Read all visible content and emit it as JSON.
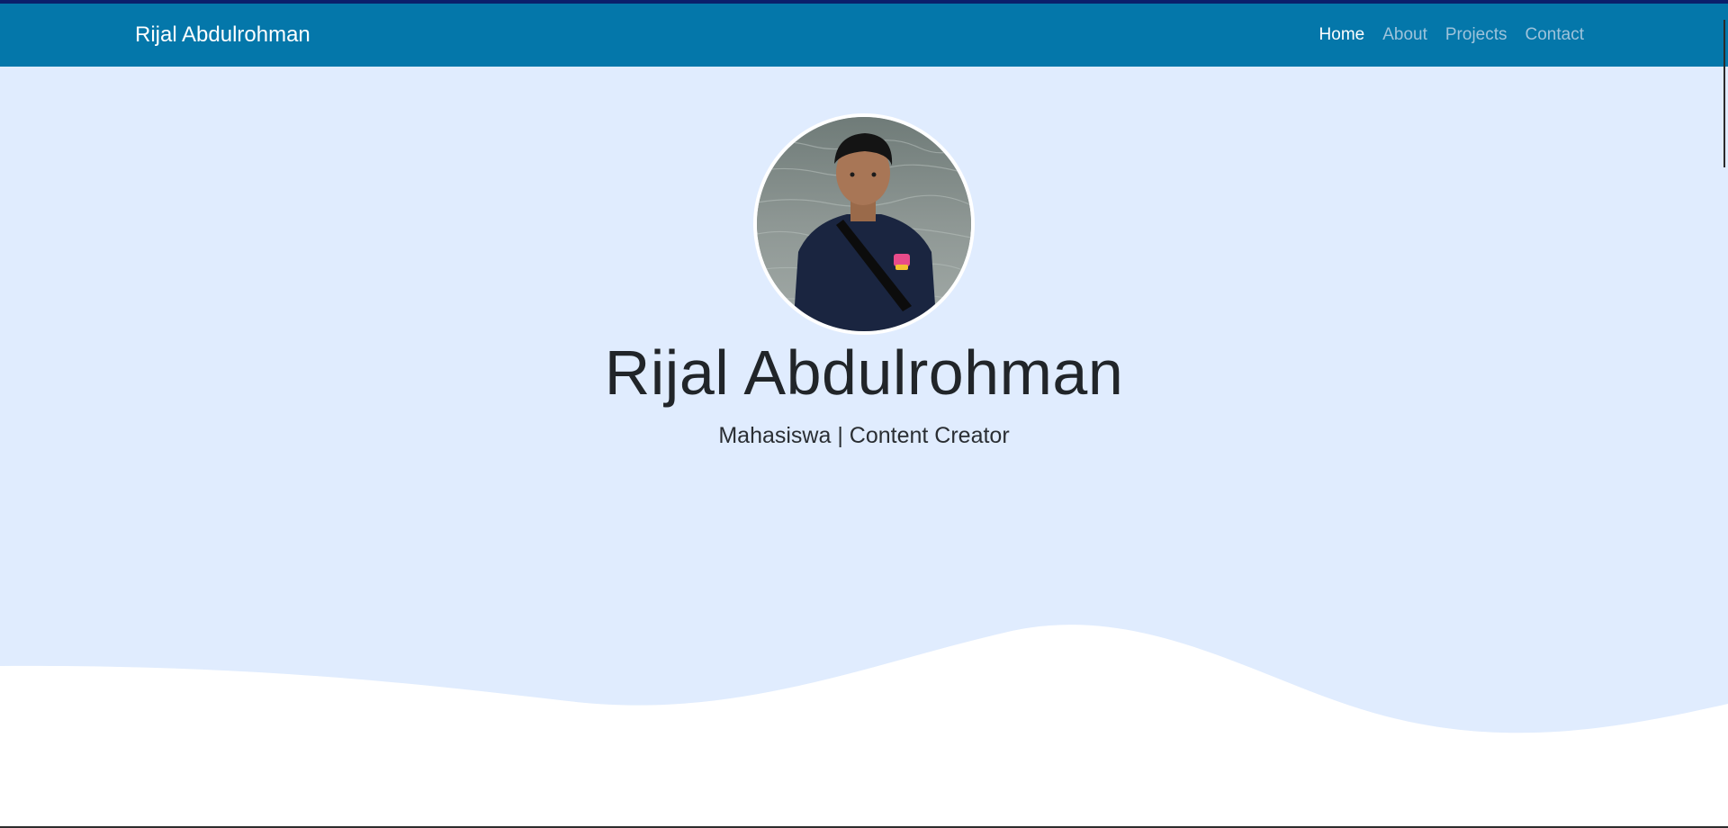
{
  "navbar": {
    "brand": "Rijal Abdulrohman",
    "links": [
      {
        "label": "Home",
        "active": true
      },
      {
        "label": "About",
        "active": false
      },
      {
        "label": "Projects",
        "active": false
      },
      {
        "label": "Contact",
        "active": false
      }
    ]
  },
  "hero": {
    "name": "Rijal Abdulrohman",
    "subtitle": "Mahasiswa | Content Creator",
    "avatar_icon": "profile-photo"
  },
  "colors": {
    "navbar_bg": "#0477aa",
    "top_strip": "#0b1f6b",
    "hero_bg": "#e0ecfe",
    "wave_fill": "#ffffff"
  }
}
